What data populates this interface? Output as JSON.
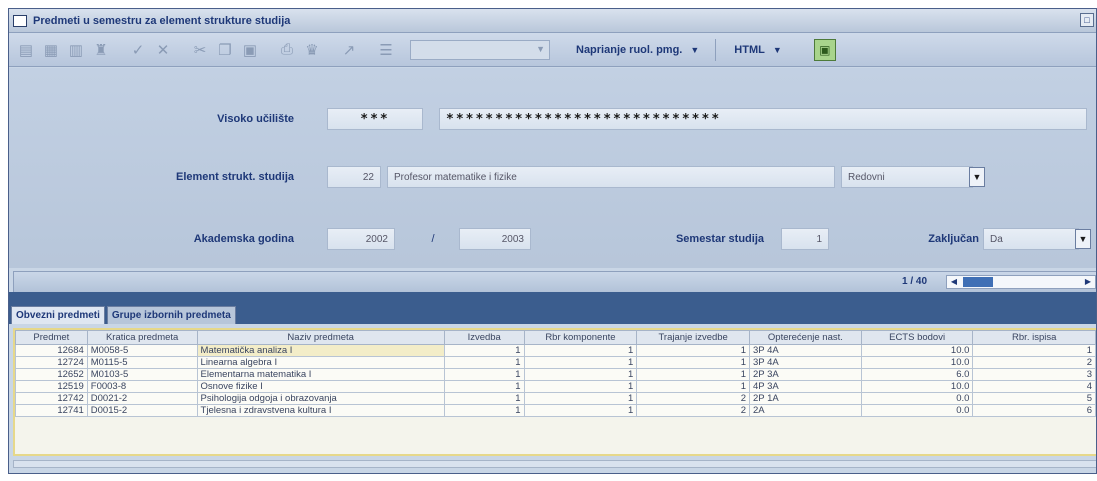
{
  "window": {
    "title": "Predmeti u semestru za element strukture studija"
  },
  "toolbar": {
    "report_label": "Naprianje ruol. pmg.",
    "format_label": "HTML"
  },
  "form": {
    "visoko_uciliste": {
      "label": "Visoko učilište",
      "code": "***",
      "name": "****************************"
    },
    "element": {
      "label": "Element strukt. studija",
      "code": "22",
      "name": "Profesor matematike i fizike",
      "type": "Redovni"
    },
    "akademska": {
      "label": "Akademska godina",
      "from": "2002",
      "sep": "/",
      "to": "2003"
    },
    "semestar": {
      "label": "Semestar studija",
      "value": "1"
    },
    "zakljucan": {
      "label": "Zaključan",
      "value": "Da"
    },
    "nav": {
      "count": "1 / 40"
    }
  },
  "tabs": [
    {
      "label": "Obvezni predmeti",
      "active": true
    },
    {
      "label": "Grupe izbornih predmeta",
      "active": false
    }
  ],
  "table": {
    "headers": [
      "Predmet",
      "Kratica predmeta",
      "Naziv predmeta",
      "Izvedba",
      "Rbr komponente",
      "Trajanje izvedbe",
      "Opterećenje nast.",
      "ECTS bodovi",
      "Rbr. ispisa"
    ],
    "rows": [
      [
        "12684",
        "M0058-5",
        "Matematička analiza I",
        "1",
        "1",
        "1",
        "3P 4A",
        "10.0",
        "1"
      ],
      [
        "12724",
        "M0115-5",
        "Linearna algebra I",
        "1",
        "1",
        "1",
        "3P 4A",
        "10.0",
        "2"
      ],
      [
        "12652",
        "M0103-5",
        "Elementarna matematika I",
        "1",
        "1",
        "1",
        "2P 3A",
        "6.0",
        "3"
      ],
      [
        "12519",
        "F0003-8",
        "Osnove fizike I",
        "1",
        "1",
        "1",
        "4P 3A",
        "10.0",
        "4"
      ],
      [
        "12742",
        "D0021-2",
        "Psihologija odgoja i obrazovanja",
        "1",
        "1",
        "2",
        "2P 1A",
        "0.0",
        "5"
      ],
      [
        "12741",
        "D0015-2",
        "Tjelesna i zdravstvena kultura I",
        "1",
        "1",
        "2",
        "2A",
        "0.0",
        "6"
      ]
    ]
  }
}
